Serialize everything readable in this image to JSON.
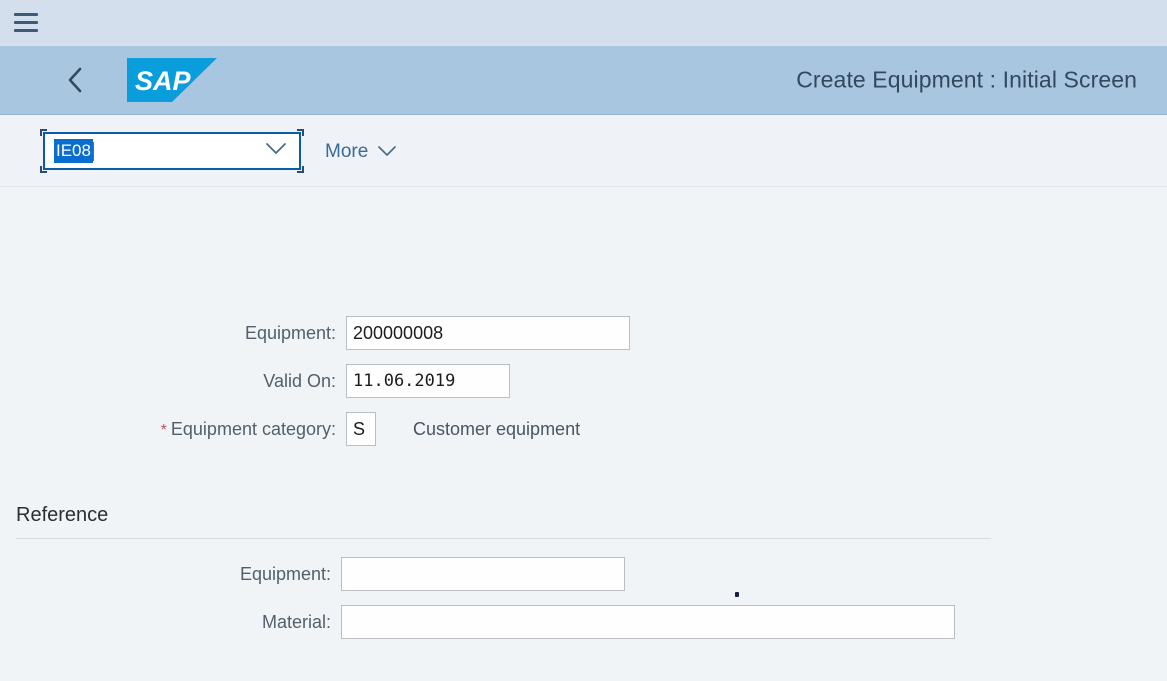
{
  "top_bar": {
    "menu_icon": "hamburger-menu-icon"
  },
  "shell_header": {
    "back_icon": "back-chevron-icon",
    "logo_text": "SAP",
    "logo_color": "#0a9ddb",
    "title": "Create Equipment : Initial Screen"
  },
  "toolbar": {
    "transaction_code": {
      "value": "IE08",
      "placeholder": "",
      "selected": true,
      "dropdown_icon": "chevron-down-icon"
    },
    "more": {
      "label": "More",
      "icon": "chevron-down-icon"
    }
  },
  "main": {
    "fields": [
      {
        "label": "Equipment:",
        "value": "200000008",
        "required": false,
        "helper": ""
      },
      {
        "label": "Valid On:",
        "value": "11.06.2019",
        "required": false,
        "helper": ""
      },
      {
        "label": "Equipment category:",
        "value": "S",
        "required": true,
        "helper": "Customer equipment"
      }
    ],
    "section": {
      "title": "Reference",
      "fields": [
        {
          "label": "Equipment:",
          "value": ""
        },
        {
          "label": "Material:",
          "value": ""
        }
      ]
    }
  },
  "colors": {
    "top_bar_bg": "#d3dfec",
    "header_bg": "#a9c6e0",
    "toolbar_bg": "#eff3f7",
    "content_bg": "#f0f4f7",
    "brand_blue": "#0a9ddb",
    "selection_blue": "#0a6ed1",
    "required_star": "#b5526c"
  }
}
